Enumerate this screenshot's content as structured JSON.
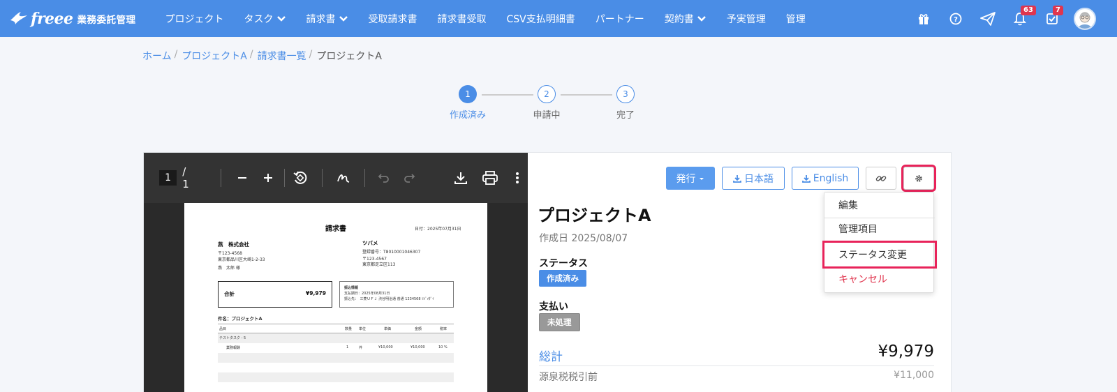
{
  "brand": {
    "name": "freee",
    "product": "業務委託管理"
  },
  "nav": {
    "items": [
      {
        "label": "プロジェクト",
        "caret": false
      },
      {
        "label": "タスク",
        "caret": true
      },
      {
        "label": "請求書",
        "caret": true
      },
      {
        "label": "受取請求書",
        "caret": false
      },
      {
        "label": "請求書受取",
        "caret": false
      },
      {
        "label": "CSV支払明細書",
        "caret": false
      },
      {
        "label": "パートナー",
        "caret": false
      },
      {
        "label": "契約書",
        "caret": true
      },
      {
        "label": "予実管理",
        "caret": false
      },
      {
        "label": "管理",
        "caret": false
      }
    ],
    "notifications_count": "63",
    "tasks_count": "7"
  },
  "breadcrumb": [
    "ホーム",
    "プロジェクトA",
    "請求書一覧",
    "プロジェクトA"
  ],
  "stepper": [
    {
      "num": "1",
      "label": "作成済み",
      "active": true
    },
    {
      "num": "2",
      "label": "申請中",
      "active": false
    },
    {
      "num": "3",
      "label": "完了",
      "active": false
    }
  ],
  "viewer": {
    "page": "1",
    "page_total": "/ 1"
  },
  "invoice": {
    "title": "請求書",
    "date": "日付：2025年07月31日",
    "client_name": "燕　株式会社",
    "client_zip": "〒123-4568",
    "client_addr": "東京都品川区大崎1-2-33",
    "client_person": "燕　太郎 様",
    "issuer_name": "ツバメ",
    "issuer_reg": "登録番号：T8010001046307",
    "issuer_zip": "〒123-4567",
    "issuer_addr": "東京都足立区113",
    "total_label": "合計",
    "total_value": "¥9,979",
    "pay_title": "振込情報",
    "pay_due": "支払期日：2025年08月31日",
    "pay_to": "振込先：　三菱ＵＦＪ 渋谷明治通 普通 1234568 ﾂﾊﾞﾒﾀﾞｲ",
    "subject": "件名：プロジェクトA",
    "columns": [
      "品目",
      "数量",
      "単位",
      "単価",
      "金額",
      "税率"
    ],
    "group": "テストタスク - 5",
    "row": {
      "item": "業務報酬",
      "qty": "1",
      "unit": "件",
      "price": "¥10,000",
      "amount": "¥10,000",
      "tax": "10 %"
    }
  },
  "actions": {
    "issue_label": "発行",
    "japanese_label": "日本語",
    "english_label": "English"
  },
  "detail": {
    "title": "プロジェクトA",
    "created": "作成日 2025/08/07",
    "status_label": "ステータス",
    "status_value": "作成済み",
    "payment_label": "支払い",
    "payment_value": "未処理",
    "sum_label": "総計",
    "sum_value": "¥9,979",
    "withholding_label": "源泉税税引前",
    "withholding_value": "¥11,000"
  },
  "menu": {
    "items": [
      "編集",
      "管理項目",
      "ステータス変更",
      "キャンセル"
    ]
  },
  "colors": {
    "primary": "#4a8de6",
    "highlight": "#e8235a",
    "danger": "#e0354e"
  }
}
